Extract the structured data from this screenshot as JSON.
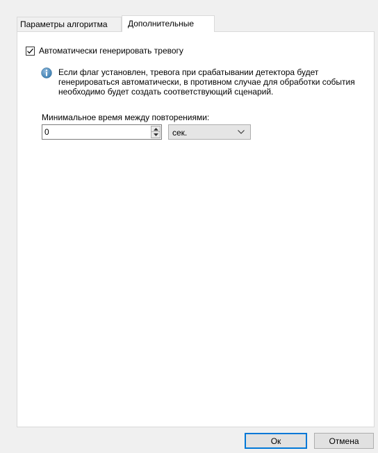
{
  "tabs": {
    "params": "Параметры алгоритма",
    "extra": "Дополнительные",
    "active": "extra"
  },
  "auto_alarm": {
    "label": "Автоматически генерировать тревогу",
    "checked": true
  },
  "info": {
    "icon": "info-icon",
    "text": "Если флаг установлен, тревога при срабатывании детектора будет генерироваться автоматически, в противном случае для обработки события необходимо будет создать соответствующий сценарий."
  },
  "min_time": {
    "label": "Минимальное время между повторениями:",
    "value": "0",
    "unit": "сек."
  },
  "buttons": {
    "ok": "Ок",
    "cancel": "Отмена"
  },
  "colors": {
    "accent": "#0078d7",
    "info_icon": "#3c7fb1",
    "panel": "#ffffff",
    "background": "#f0f0f0"
  }
}
